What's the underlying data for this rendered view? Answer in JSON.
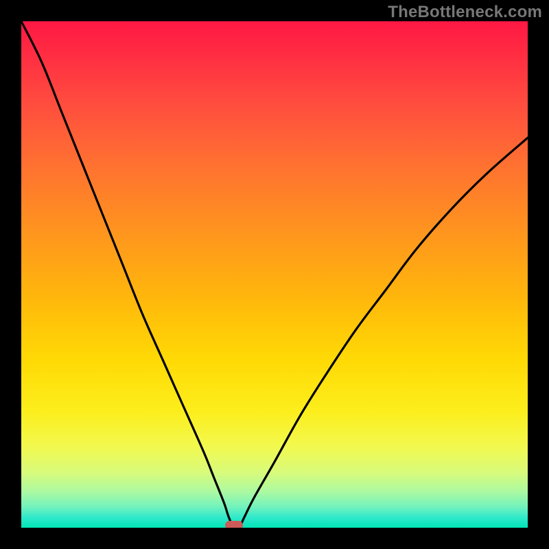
{
  "watermark": "TheBottleneck.com",
  "colors": {
    "frame": "#000000",
    "gradient_top": "#ff1844",
    "gradient_bottom": "#00e4b5",
    "curve_stroke": "#000000",
    "marker": "#cc5a58"
  },
  "chart_data": {
    "type": "line",
    "title": "",
    "xlabel": "",
    "ylabel": "",
    "xlim": [
      0,
      100
    ],
    "ylim": [
      0,
      100
    ],
    "notch_x": 42,
    "marker": {
      "x": 42,
      "y": 0,
      "width_pct": 3.5
    },
    "series": [
      {
        "name": "bottleneck-curve",
        "x": [
          0,
          4,
          8,
          12,
          16,
          20,
          24,
          28,
          32,
          36,
          38,
          40,
          41,
          42,
          43,
          44,
          46,
          50,
          55,
          60,
          66,
          72,
          78,
          85,
          92,
          100
        ],
        "y": [
          100,
          92,
          82,
          72,
          62,
          52,
          42,
          33,
          24,
          15,
          10,
          5,
          2,
          0,
          0,
          2,
          6,
          13,
          22,
          30,
          39,
          47,
          55,
          63,
          70,
          77
        ]
      }
    ],
    "annotations": []
  }
}
